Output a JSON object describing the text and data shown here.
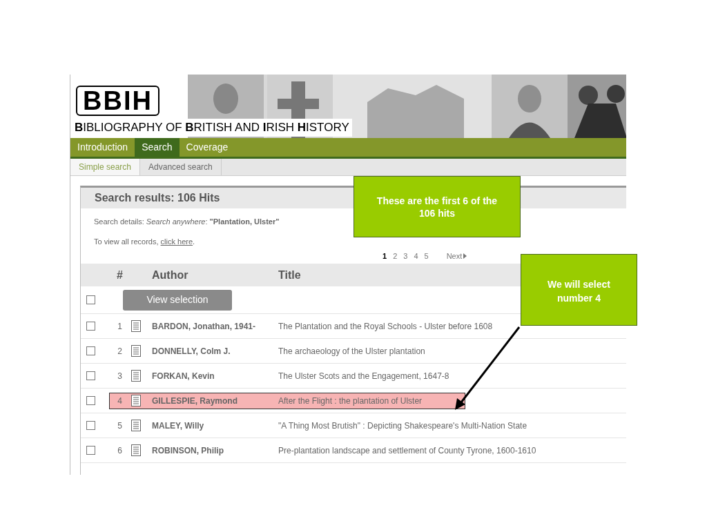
{
  "header": {
    "logo": "BBIH",
    "title": "**B**IBLIOGRAPHY OF **B**RITISH AND **I**RISH **H**ISTORY"
  },
  "nav": [
    {
      "label": "Introduction",
      "selected": false
    },
    {
      "label": "Search",
      "selected": true
    },
    {
      "label": "Coverage",
      "selected": false
    }
  ],
  "subnav": [
    {
      "label": "Simple search",
      "selected": true
    },
    {
      "label": "Advanced search",
      "selected": false
    }
  ],
  "results": {
    "heading": "Search results: 106 Hits",
    "details": "Search details: *Search anywhere*: **\"Plantation, Ulster\"**",
    "view_all": {
      "text": "To view all records,",
      "link": "click here",
      "after": "."
    }
  },
  "pagination": {
    "pages": [
      {
        "label": "1",
        "selected": true
      },
      {
        "label": "2",
        "selected": false
      },
      {
        "label": "3",
        "selected": false
      },
      {
        "label": "4",
        "selected": false
      },
      {
        "label": "5",
        "selected": false
      }
    ],
    "next": "Next"
  },
  "table": {
    "columns": [
      "#",
      "Author",
      "Title"
    ],
    "select_all": {
      "checked": false
    },
    "view_selection": "View selection",
    "rows": [
      {
        "number": "1",
        "author": "BARDON, Jonathan, 1941-",
        "title": "The Plantation and the Royal Schools - Ulster before 1608",
        "checked": false,
        "highlighted": false
      },
      {
        "number": "2",
        "author": "DONNELLY, Colm J.",
        "title": "The archaeology of the Ulster plantation",
        "checked": false,
        "highlighted": false
      },
      {
        "number": "3",
        "author": "FORKAN, Kevin",
        "title": "The Ulster Scots and the Engagement, 1647-8",
        "checked": false,
        "highlighted": false
      },
      {
        "number": "4",
        "author": "GILLESPIE, Raymond",
        "title": "After the Flight : the plantation of Ulster",
        "checked": false,
        "highlighted": true
      },
      {
        "number": "5",
        "author": "MALEY, Willy",
        "title": "\"A Thing Most Brutish\" : Depicting Shakespeare's Multi-Nation State",
        "checked": false,
        "highlighted": false
      },
      {
        "number": "6",
        "author": "ROBINSON, Philip",
        "title": "Pre-plantation landscape and settlement of County Tyrone, 1600-1610",
        "checked": false,
        "highlighted": false
      }
    ]
  },
  "callouts": [
    {
      "text": "These are the first 6 of the 106 hits"
    },
    {
      "text": "We will select number 4"
    }
  ]
}
